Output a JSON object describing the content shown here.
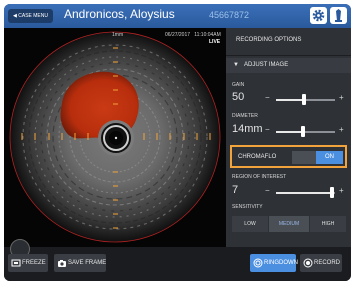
{
  "header": {
    "case_menu": "CASE MENU",
    "patient_name": "Andronicos, Aloysius",
    "patient_id": "45667872"
  },
  "image": {
    "scale_label": "1mm",
    "date": "06/27/2017",
    "time": "11:10:04AM",
    "live": "LIVE"
  },
  "panel": {
    "title": "RECORDING OPTIONS",
    "adjust_label": "ADJUST IMAGE",
    "gain": {
      "label": "GAIN",
      "value": "50",
      "level": 0.48
    },
    "diameter": {
      "label": "DIAMETER",
      "value": "14mm",
      "level": 0.45
    },
    "chromaflo": {
      "label": "CHROMAFLO",
      "state": "ON"
    },
    "roi": {
      "label": "REGION OF INTEREST",
      "value": "7",
      "level": 0.95
    },
    "sensitivity": {
      "label": "SENSITIVITY",
      "options": [
        "LOW",
        "MEDIUM",
        "HIGH"
      ],
      "selected": "MEDIUM"
    },
    "minus": "−",
    "plus": "+"
  },
  "bottom": {
    "freeze": "FREEZE",
    "save_frame": "SAVE FRAME",
    "ringdown": "RINGDOWN",
    "record": "RECORD"
  },
  "colors": {
    "accent": "#4b8fe0",
    "highlight": "#f2a33b",
    "header": "#2c5fa6"
  }
}
